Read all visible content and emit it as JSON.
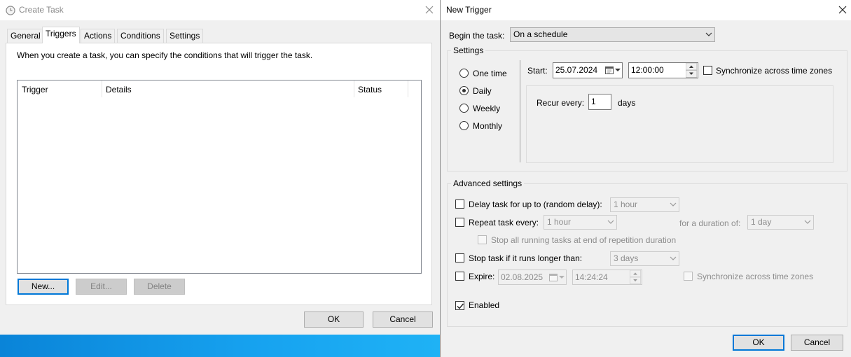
{
  "create_task": {
    "title": "Create Task",
    "tabs": [
      "General",
      "Triggers",
      "Actions",
      "Conditions",
      "Settings"
    ],
    "description": "When you create a task, you can specify the conditions that will trigger the task.",
    "columns": [
      "Trigger",
      "Details",
      "Status"
    ],
    "buttons": {
      "new": "New...",
      "edit": "Edit...",
      "delete": "Delete"
    },
    "ok": "OK",
    "cancel": "Cancel"
  },
  "new_trigger": {
    "title": "New Trigger",
    "begin_label": "Begin the task:",
    "begin_value": "On a schedule",
    "settings_label": "Settings",
    "schedule_options": [
      "One time",
      "Daily",
      "Weekly",
      "Monthly"
    ],
    "selected_schedule": "Daily",
    "start_label": "Start:",
    "start_date": "25.07.2024",
    "start_time": "12:00:00",
    "sync_label": "Synchronize across time zones",
    "recur_label": "Recur every:",
    "recur_value": "1",
    "recur_unit": "days",
    "advanced": {
      "label": "Advanced settings",
      "delay_label": "Delay task for up to (random delay):",
      "delay_value": "1 hour",
      "repeat_label": "Repeat task every:",
      "repeat_value": "1 hour",
      "duration_label": "for a duration of:",
      "duration_value": "1 day",
      "stop_all_label": "Stop all running tasks at end of repetition duration",
      "stop_longer_label": "Stop task if it runs longer than:",
      "stop_longer_value": "3 days",
      "expire_label": "Expire:",
      "expire_date": "02.08.2025",
      "expire_time": "14:24:24",
      "expire_sync_label": "Synchronize across time zones",
      "enabled_label": "Enabled",
      "enabled": true
    },
    "ok": "OK",
    "cancel": "Cancel"
  },
  "colors": {
    "accent": "#0078d7",
    "taskbar": "#1196e4",
    "disabled_text": "#8d8d8d"
  },
  "icons": [
    "clock-icon",
    "close-icon",
    "calendar-icon",
    "chevron-down-icon",
    "spin-icon",
    "checkmark-icon"
  ]
}
